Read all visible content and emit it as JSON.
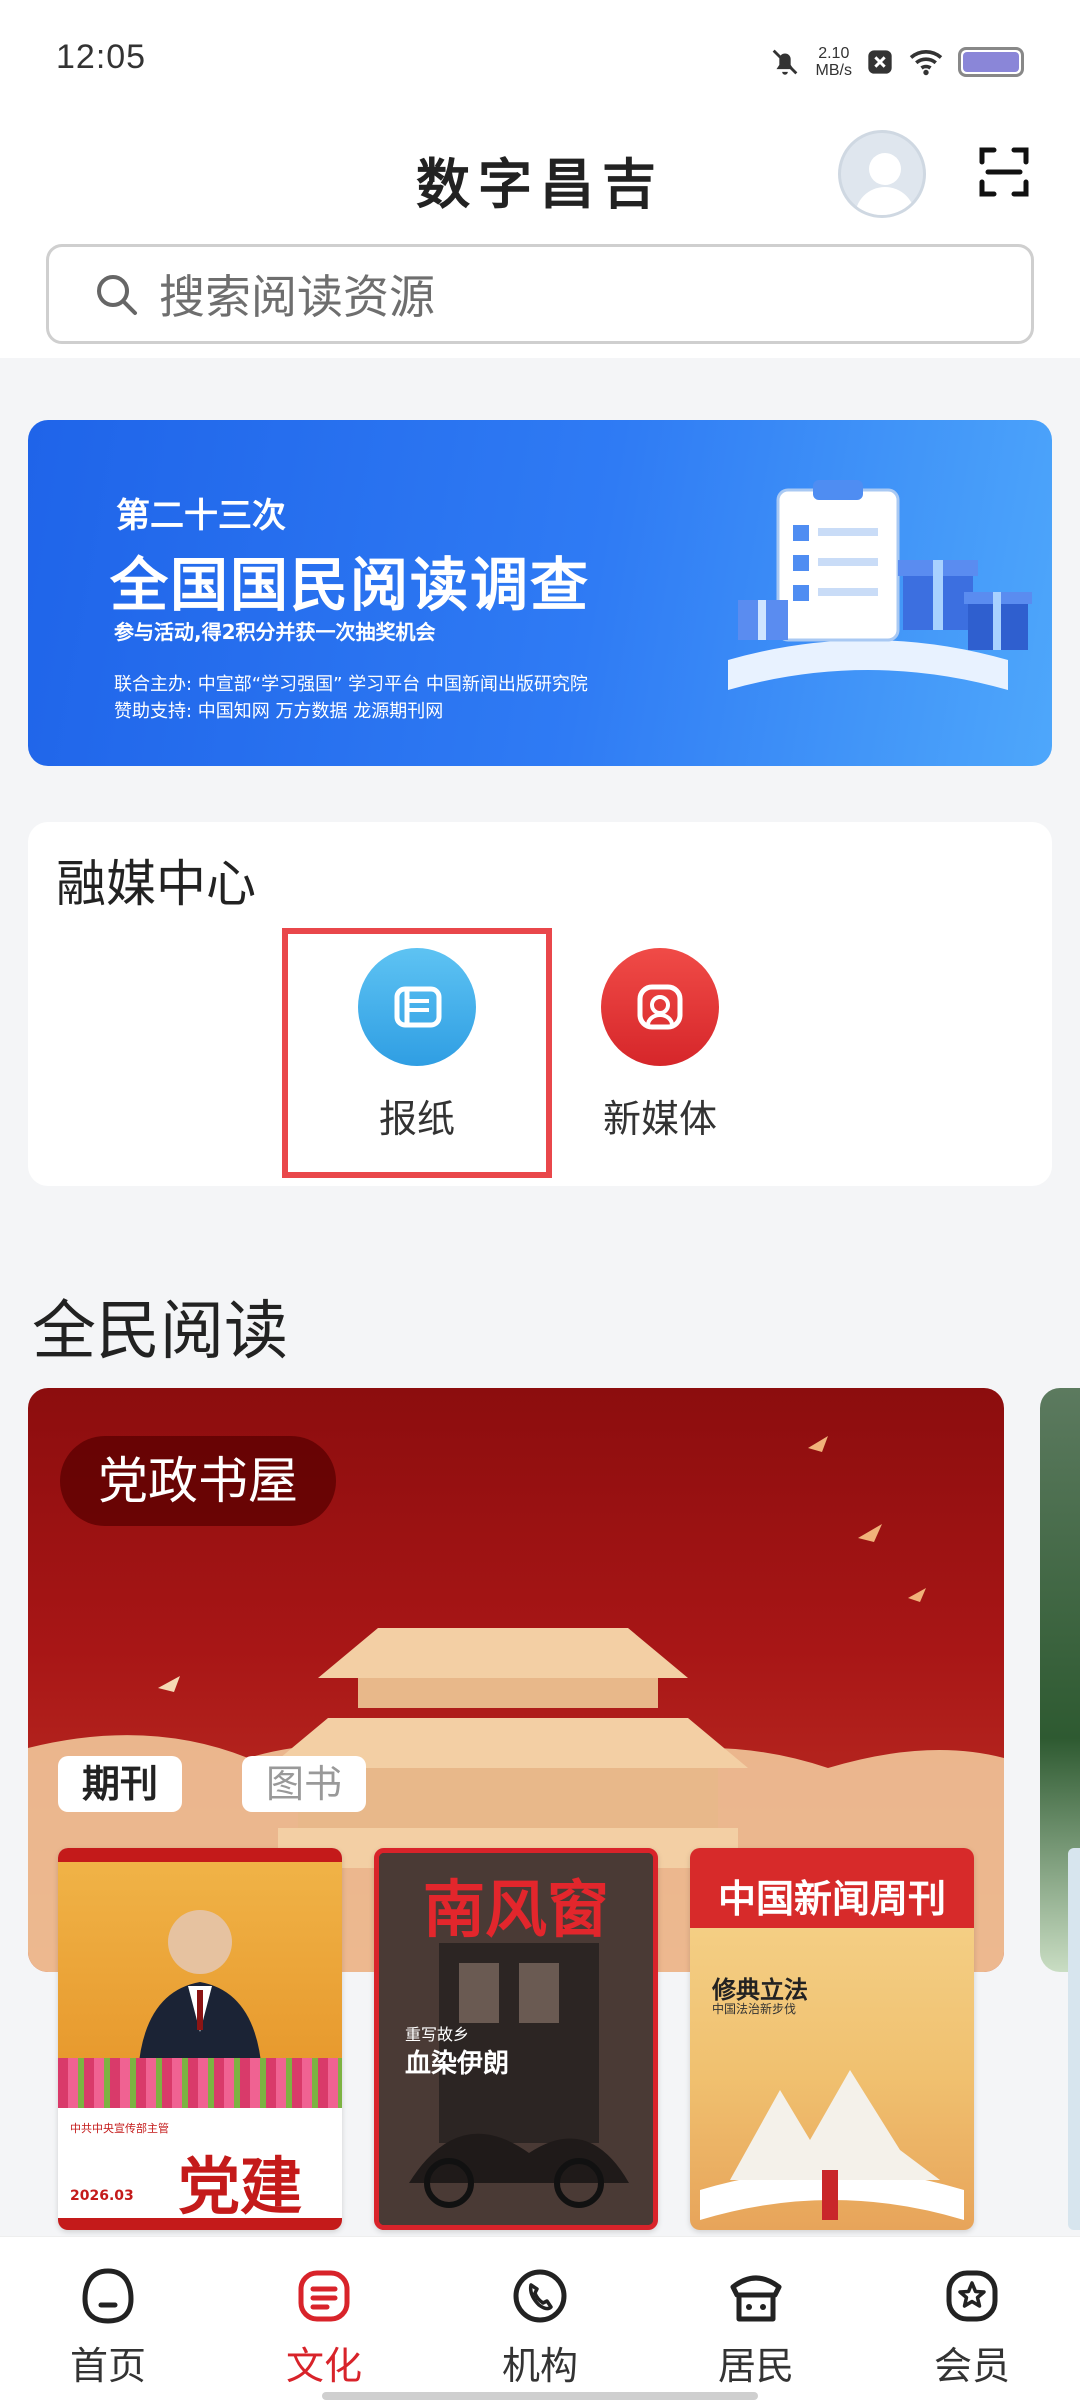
{
  "status_bar": {
    "time": "12:05",
    "net_speed_value": "2.10",
    "net_speed_unit": "MB/s"
  },
  "header": {
    "title": "数字昌吉",
    "search_placeholder": "搜索阅读资源"
  },
  "banner": {
    "line1": "第二十三次",
    "line2": "全国国民阅读调查",
    "line3": "参与活动,得2积分并获一次抽奖机会",
    "line4": "联合主办:  中宣部“学习强国”  学习平台   中国新闻出版研究院",
    "line5": "赞助支持:  中国知网   万方数据   龙源期刊网"
  },
  "media_center": {
    "title": "融媒中心",
    "items": [
      {
        "label": "报纸",
        "icon": "newspaper-icon"
      },
      {
        "label": "新媒体",
        "icon": "media-icon"
      }
    ]
  },
  "reading": {
    "title": "全民阅读",
    "tag": "党政书屋",
    "tabs": [
      "期刊",
      "图书"
    ],
    "magazines": [
      {
        "title": "党建",
        "issue": "2026.03",
        "top_text": "中共中央宣传部主管"
      },
      {
        "title": "南风窗",
        "headline": "血染伊朗",
        "sub": "重写故乡"
      },
      {
        "title": "中国新闻周刊",
        "headline": "修典立法",
        "sub": "中国法治新步伐"
      }
    ]
  },
  "bottom_nav": {
    "items": [
      {
        "label": "首页",
        "icon": "home-icon",
        "active": false
      },
      {
        "label": "文化",
        "icon": "culture-icon",
        "active": true
      },
      {
        "label": "机构",
        "icon": "phone-icon",
        "active": false
      },
      {
        "label": "居民",
        "icon": "resident-icon",
        "active": false
      },
      {
        "label": "会员",
        "icon": "member-star-icon",
        "active": false
      }
    ]
  },
  "colors": {
    "accent": "#d8232a",
    "banner_blue": "#2f7bf4",
    "newspaper_blue": "#3fb0ea",
    "media_red": "#e0322f"
  }
}
